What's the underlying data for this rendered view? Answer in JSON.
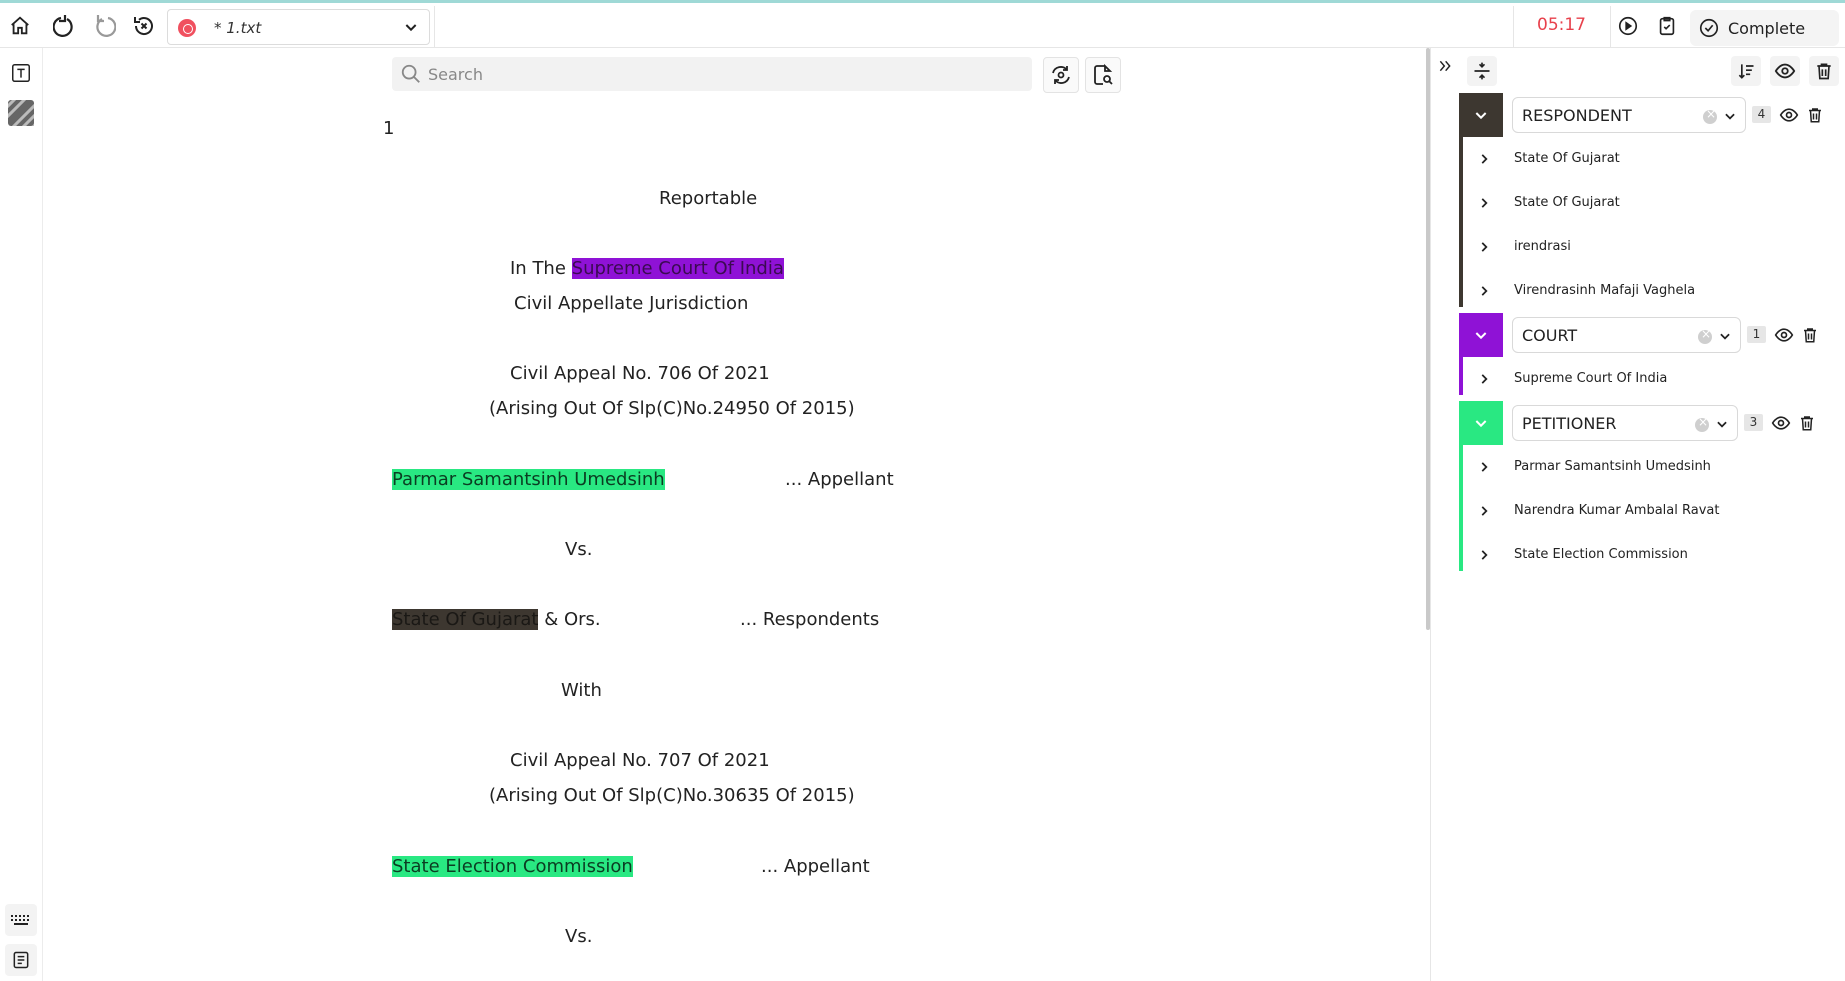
{
  "toolbar": {
    "file_name": "* 1.txt",
    "timer": "05:17",
    "complete_label": "Complete",
    "icons": [
      "home-icon",
      "undo-icon",
      "redo-icon",
      "reset-icon",
      "record-icon",
      "clipboard-check-icon",
      "check-circle-icon"
    ]
  },
  "left_rail": {
    "icons": [
      "text-tool-icon",
      "hatch-pattern-icon",
      "keyboard-icon",
      "form-icon"
    ]
  },
  "search": {
    "placeholder": "Search"
  },
  "document": {
    "page_number": "1",
    "lines": {
      "reportable": "Reportable",
      "in_the": "In The ",
      "court_name": "Supreme Court Of India",
      "jurisdiction": "Civil Appellate Jurisdiction",
      "appeal1": "Civil Appeal No. 706 Of 2021",
      "arising1": "(Arising Out Of Slp(C)No.24950 Of 2015)",
      "appellant1_name": "Parmar Samantsinh Umedsinh",
      "appellant1_role": "... Appellant",
      "vs1": "Vs.",
      "respondent_name": "State Of Gujarat",
      "respondent_suffix": " & Ors.",
      "respondent_role": "... Respondents",
      "with": "With",
      "appeal2": "Civil Appeal No. 707 Of 2021",
      "arising2": "(Arising Out Of Slp(C)No.30635 Of 2015)",
      "appellant2_name": "State Election Commission",
      "appellant2_role": "... Appellant",
      "vs2": "Vs."
    }
  },
  "panel": {
    "groups": [
      {
        "label": "RESPONDENT",
        "count": "4",
        "color": "#3d3730",
        "entities": [
          "State Of Gujarat",
          "State Of Gujarat",
          "irendrasi",
          "Virendrasinh Mafaji Vaghela"
        ]
      },
      {
        "label": "COURT",
        "count": "1",
        "color": "#8f12d6",
        "entities": [
          "Supreme Court Of India"
        ]
      },
      {
        "label": "PETITIONER",
        "count": "3",
        "color": "#29e882",
        "entities": [
          "Parmar Samantsinh Umedsinh",
          "Narendra Kumar Ambalal Ravat",
          "State Election Commission"
        ]
      }
    ]
  }
}
